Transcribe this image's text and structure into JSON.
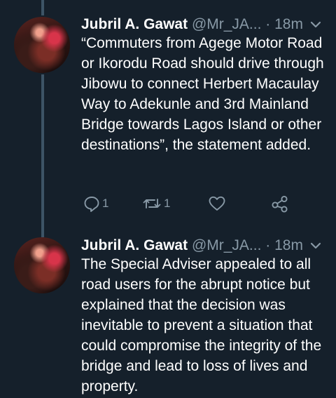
{
  "tweets": [
    {
      "author_name": "Jubril A. Gawat",
      "handle": "@Mr_JA...",
      "separator": "·",
      "time": "18m",
      "text": "“Commuters from Agege Motor Road or Ikorodu Road should drive through Jibowu to connect Herbert Macaulay Way to Adekunle and 3rd Mainland Bridge towards Lagos Island or other destinations”, the statement added.",
      "reply_count": "1",
      "retweet_count": "1"
    },
    {
      "author_name": "Jubril A. Gawat",
      "handle": "@Mr_JA...",
      "separator": "·",
      "time": "18m",
      "text": "The Special Adviser appealed to all road users for the abrupt notice but explained that the decision was inevitable to prevent a situation that could compromise the integrity of the bridge and lead to loss of lives and property."
    }
  ],
  "icons": {
    "reply": "reply-icon",
    "retweet": "retweet-icon",
    "like": "heart-icon",
    "share": "share-icon",
    "menu": "chevron-down-icon"
  },
  "colors": {
    "background": "#15202b",
    "text": "#ffffff",
    "secondary": "#8899a6",
    "thread_line": "#3d5466"
  }
}
